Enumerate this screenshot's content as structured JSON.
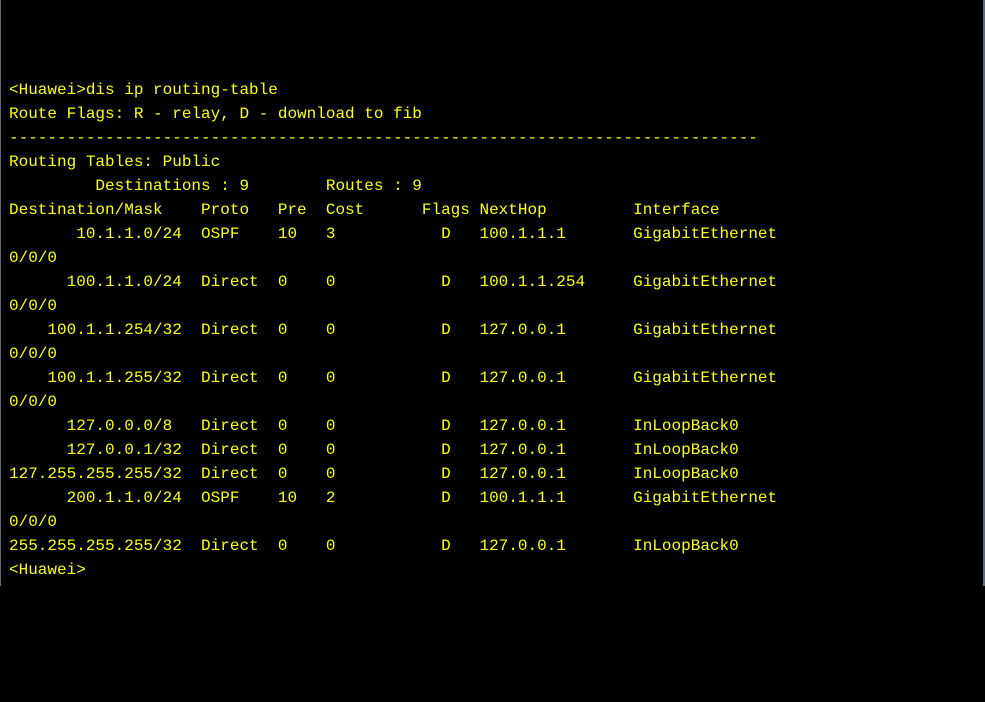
{
  "prompt_prefix": "<Huawei>",
  "command": "dis ip routing-table",
  "route_flags_line": "Route Flags: R - relay, D - download to fib",
  "separator": "------------------------------------------------------------------------------",
  "tables_line": "Routing Tables: Public",
  "dest_count_label": "         Destinations : 9        Routes : 9",
  "blank": "",
  "header": "Destination/Mask    Proto   Pre  Cost      Flags NextHop         Interface",
  "rows": [
    "       10.1.1.0/24  OSPF    10   3           D   100.1.1.1       GigabitEthernet",
    "0/0/0",
    "      100.1.1.0/24  Direct  0    0           D   100.1.1.254     GigabitEthernet",
    "0/0/0",
    "    100.1.1.254/32  Direct  0    0           D   127.0.0.1       GigabitEthernet",
    "0/0/0",
    "    100.1.1.255/32  Direct  0    0           D   127.0.0.1       GigabitEthernet",
    "0/0/0",
    "      127.0.0.0/8   Direct  0    0           D   127.0.0.1       InLoopBack0",
    "      127.0.0.1/32  Direct  0    0           D   127.0.0.1       InLoopBack0",
    "127.255.255.255/32  Direct  0    0           D   127.0.0.1       InLoopBack0",
    "      200.1.1.0/24  OSPF    10   2           D   100.1.1.1       GigabitEthernet",
    "0/0/0",
    "255.255.255.255/32  Direct  0    0           D   127.0.0.1       InLoopBack0"
  ],
  "end_prompt": "<Huawei>"
}
